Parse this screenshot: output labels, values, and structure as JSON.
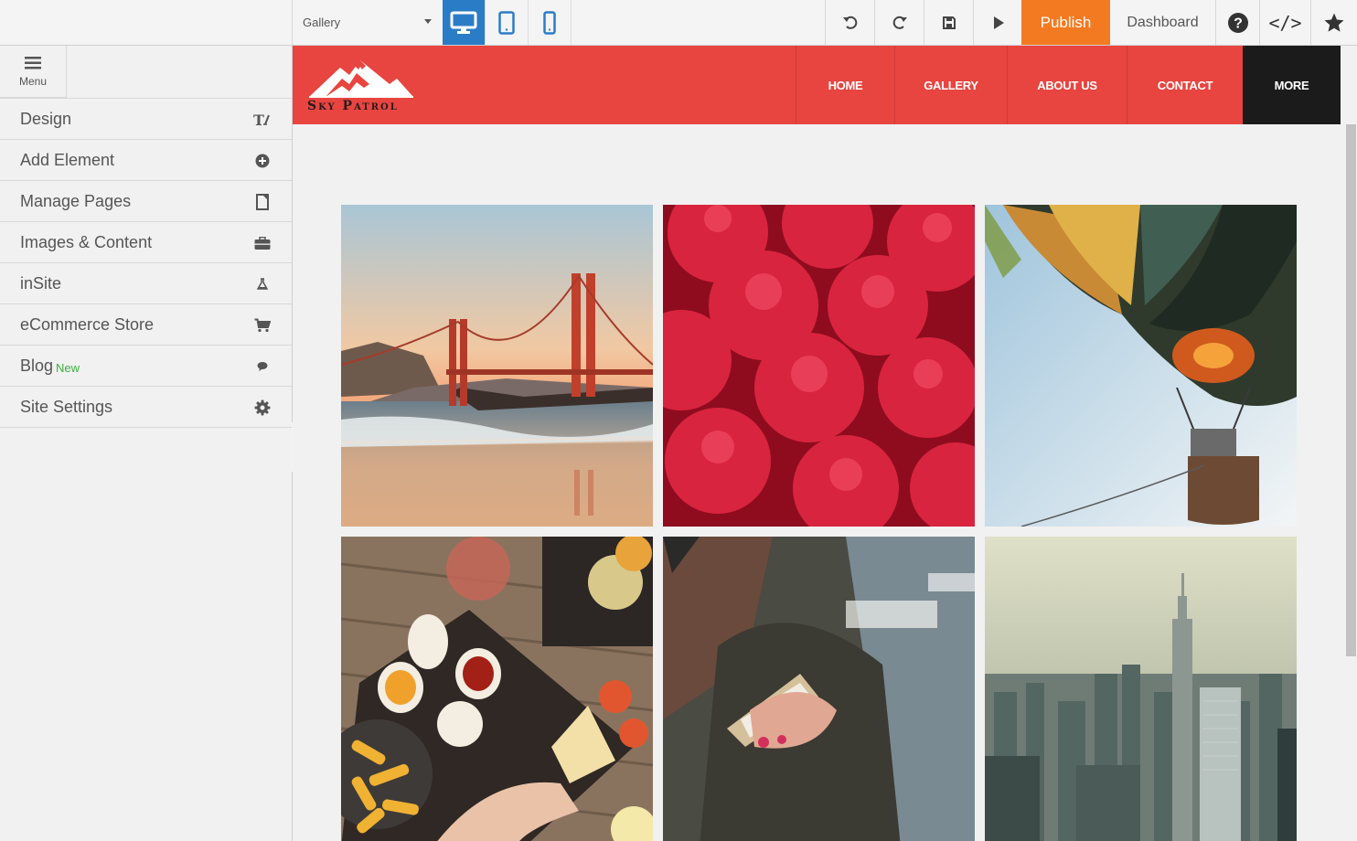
{
  "toolbar": {
    "page_selector": "Gallery",
    "publish_label": "Publish",
    "dashboard_label": "Dashboard",
    "code_label": "</>",
    "help_label": "?"
  },
  "sidebar": {
    "menu_label": "Menu",
    "items": [
      {
        "label": "Design",
        "icon": "text-format-icon"
      },
      {
        "label": "Add Element",
        "icon": "plus-circle-icon"
      },
      {
        "label": "Manage Pages",
        "icon": "page-icon"
      },
      {
        "label": "Images & Content",
        "icon": "briefcase-icon"
      },
      {
        "label": "inSite",
        "icon": "flask-icon"
      },
      {
        "label": "eCommerce Store",
        "icon": "cart-icon"
      },
      {
        "label": "Blog",
        "badge": "New",
        "icon": "speech-bubble-icon"
      },
      {
        "label": "Site Settings",
        "icon": "gear-icon"
      }
    ]
  },
  "site": {
    "logo_text": "Sky Patrol",
    "nav": [
      "HOME",
      "GALLERY",
      "ABOUT US",
      "CONTACT",
      "MORE"
    ],
    "brand_color": "#e84540"
  },
  "colors": {
    "accent": "#f47a22",
    "device_active": "#2b7cc7",
    "new_badge": "#3cae3c"
  }
}
